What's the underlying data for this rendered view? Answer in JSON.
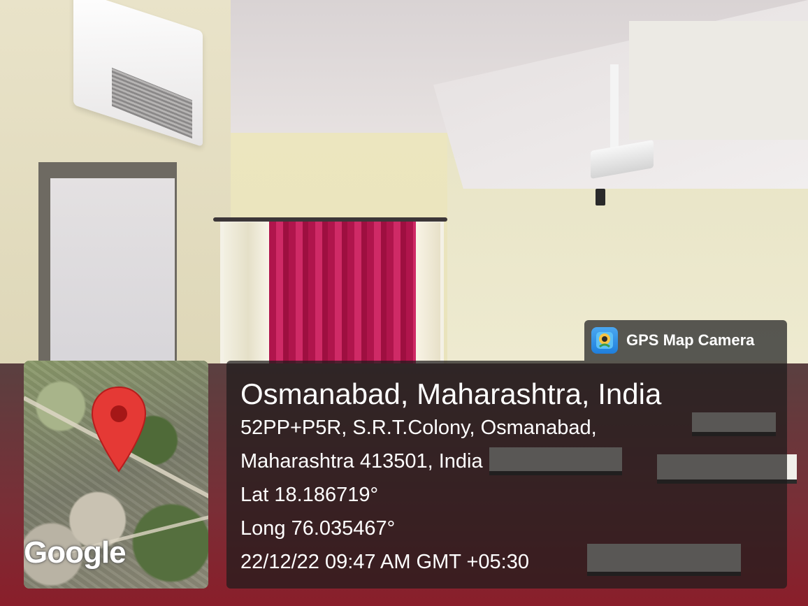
{
  "badge": {
    "label": "GPS Map Camera",
    "icon": "gps-map-camera-app-icon"
  },
  "map": {
    "logo": "Google",
    "pin_icon": "location-pin-icon",
    "pin_color": "#e53935"
  },
  "location": {
    "title": "Osmanabad, Maharashtra, India",
    "address_line1": "52PP+P5R, S.R.T.Colony, Osmanabad,",
    "address_line2": "Maharashtra 413501, India",
    "latitude": "Lat 18.186719°",
    "longitude": "Long 76.035467°",
    "timestamp": "22/12/22 09:47 AM GMT +05:30"
  }
}
